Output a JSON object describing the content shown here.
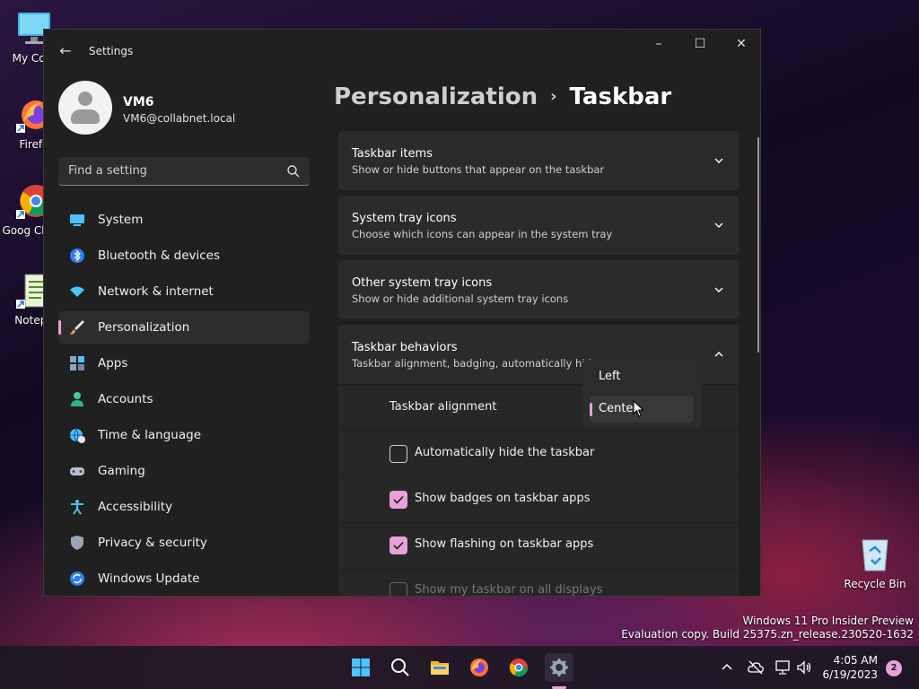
{
  "desktop": {
    "icons": [
      {
        "label": "My Com"
      },
      {
        "label": "Firefo"
      },
      {
        "label": "Goog Chron"
      },
      {
        "label": "Notepa"
      },
      {
        "label": "Recycle Bin"
      }
    ]
  },
  "window": {
    "title": "Settings",
    "controls": {
      "minimize": "–",
      "maximize": "☐",
      "close": "✕"
    },
    "back": "←"
  },
  "profile": {
    "name": "VM6",
    "email": "VM6@collabnet.local"
  },
  "search": {
    "placeholder": "Find a setting"
  },
  "nav": [
    {
      "label": "System",
      "icon": "monitor-icon"
    },
    {
      "label": "Bluetooth & devices",
      "icon": "bluetooth-icon"
    },
    {
      "label": "Network & internet",
      "icon": "wifi-icon"
    },
    {
      "label": "Personalization",
      "icon": "brush-icon",
      "active": true
    },
    {
      "label": "Apps",
      "icon": "apps-icon"
    },
    {
      "label": "Accounts",
      "icon": "person-icon"
    },
    {
      "label": "Time & language",
      "icon": "globe-clock-icon"
    },
    {
      "label": "Gaming",
      "icon": "gamepad-icon"
    },
    {
      "label": "Accessibility",
      "icon": "accessibility-icon"
    },
    {
      "label": "Privacy & security",
      "icon": "shield-icon"
    },
    {
      "label": "Windows Update",
      "icon": "update-icon"
    }
  ],
  "breadcrumb": {
    "parent": "Personalization",
    "separator": "›",
    "current": "Taskbar"
  },
  "sections": [
    {
      "title": "Taskbar items",
      "subtitle": "Show or hide buttons that appear on the taskbar",
      "expanded": false
    },
    {
      "title": "System tray icons",
      "subtitle": "Choose which icons can appear in the system tray",
      "expanded": false
    },
    {
      "title": "Other system tray icons",
      "subtitle": "Show or hide additional system tray icons",
      "expanded": false
    },
    {
      "title": "Taskbar behaviors",
      "subtitle": "Taskbar alignment, badging, automatically hide,",
      "expanded": true
    }
  ],
  "behaviors": {
    "alignment_label": "Taskbar alignment",
    "alignment_options": [
      "Left",
      "Center"
    ],
    "alignment_selected": "Center",
    "checkboxes": [
      {
        "label": "Automatically hide the taskbar",
        "checked": false
      },
      {
        "label": "Show badges on taskbar apps",
        "checked": true
      },
      {
        "label": "Show flashing on taskbar apps",
        "checked": true
      },
      {
        "label": "Show my taskbar on all displays",
        "checked": false
      }
    ]
  },
  "watermark": {
    "line1": "Windows 11 Pro Insider Preview",
    "line2": "Evaluation copy. Build 25375.zn_release.230520-1632"
  },
  "taskbar": {
    "clock_time": "4:05 AM",
    "clock_date": "6/19/2023",
    "notification_count": "2"
  },
  "colors": {
    "accent": "#e7a2d9",
    "window_bg": "#202020",
    "card_bg": "#2b2b2b"
  }
}
